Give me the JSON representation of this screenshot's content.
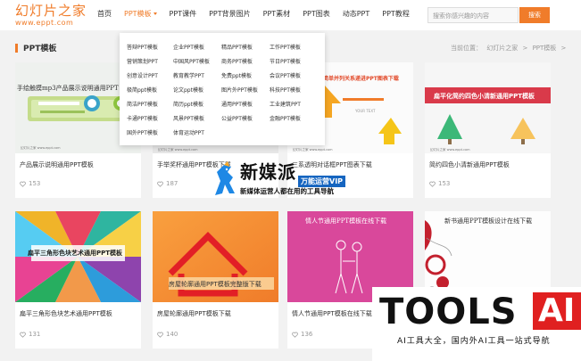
{
  "header": {
    "logo_title": "幻灯片之家",
    "logo_url": "www.eppt.com",
    "nav": [
      "首页",
      "PPT模板",
      "PPT课件",
      "PPT背景图片",
      "PPT素材",
      "PPT图表",
      "动态PPT",
      "PPT教程"
    ],
    "search_placeholder": "搜索你感兴趣的内容",
    "search_button": "搜索"
  },
  "section": {
    "title": "PPT模板",
    "breadcrumb": [
      "当前位置：",
      "幻灯片之家",
      ">",
      "PPT模板",
      ">"
    ]
  },
  "dropdown": {
    "columns": [
      [
        "答辩PPT模板",
        "营销策划PPT",
        "创意设计PPT",
        "极简ppt模板",
        "简洁PPT模板",
        "卡通PPT模板",
        "国外PPT模板"
      ],
      [
        "企业PPT模板",
        "中国风PPT模板",
        "教育教学PPT",
        "论文ppt模板",
        "简历ppt模板",
        "风景PPT模板",
        "体育运动PPT"
      ],
      [
        "精品PPT模板",
        "商务PPT模板",
        "免费ppt模板",
        "图片外PPT模板",
        "通用PPT模板",
        "公益PPT模板"
      ],
      [
        "工作PPT模板",
        "节日PPT模板",
        "会议PPT模板",
        "科技PPT模板",
        "工业建筑PPT",
        "金融PPT模板"
      ]
    ]
  },
  "cards": [
    {
      "title": "产品展示说明通用PPT模板",
      "likes": "153",
      "thumb_text": "手绘触摸mp3产品展示说明通用PPT"
    },
    {
      "title": "手举奖杯通用PPT模板下载",
      "likes": "187",
      "thumb_text": ""
    },
    {
      "title": "三系透明对话框PPT图表下载",
      "likes": "",
      "thumb_text": "彩色简单并列关系递进PPT图表下载"
    },
    {
      "title": "简约四色小清新通用PPT模板",
      "likes": "153",
      "thumb_text": "扁平化简约四色小清新通用PPT模板"
    },
    {
      "title": "扁平三角形色块艺术通用PPT模板",
      "likes": "131",
      "thumb_text": "扁平三角形色块艺术通用PPT模板"
    },
    {
      "title": "房屋轮廓通用PPT模板下载",
      "likes": "140",
      "thumb_text": "房屋轮廓通用PPT模板完整版下载"
    },
    {
      "title": "情人节通用PPT模板在线下载",
      "likes": "136",
      "thumb_text": "情人节通用PPT模板在线下载"
    },
    {
      "title": "",
      "likes": "",
      "thumb_text": "新书通用PPT模板设计在线下载"
    }
  ],
  "overlay_xmp": {
    "name": "新媒派",
    "vip": "万能运营VIP",
    "subtitle": "新媒体运营人都在用的工具导航"
  },
  "overlay_tools": {
    "word": "TOOLS",
    "ai": "AI",
    "subtitle": "AI工具大全，国内外AI工具一站式导航"
  },
  "colors": {
    "accent": "#f07c2a",
    "overlay_blue": "#1565c0",
    "overlay_red": "#e02020"
  }
}
